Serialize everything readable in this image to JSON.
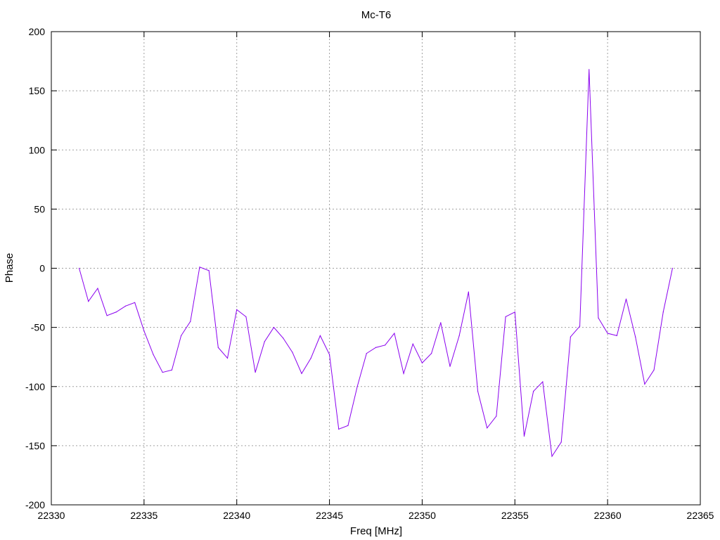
{
  "chart_data": {
    "type": "line",
    "title": "Mc-T6",
    "xlabel": "Freq [MHz]",
    "ylabel": "Phase",
    "xlim": [
      22330,
      22365
    ],
    "ylim": [
      -200,
      200
    ],
    "xticks": [
      22330,
      22335,
      22340,
      22345,
      22350,
      22355,
      22360,
      22365
    ],
    "yticks": [
      -200,
      -150,
      -100,
      -50,
      0,
      50,
      100,
      150,
      200
    ],
    "grid": true,
    "legend": "none",
    "series_color": "#8a00ef",
    "series": [
      {
        "x": [
          22331.5,
          22332,
          22332.5,
          22333,
          22333.5,
          22334,
          22334.5,
          22335,
          22335.5,
          22336,
          22336.5,
          22337,
          22337.5,
          22338,
          22338.5,
          22339,
          22339.5,
          22340,
          22340.5,
          22341,
          22341.5,
          22342,
          22342.5,
          22343,
          22343.5,
          22344,
          22344.5,
          22345,
          22345.5,
          22346,
          22346.5,
          22347,
          22347.5,
          22348,
          22348.5,
          22349,
          22349.5,
          22350,
          22350.5,
          22351,
          22351.5,
          22352,
          22352.5,
          22353,
          22353.5,
          22354,
          22354.5,
          22355,
          22355.5,
          22356,
          22356.5,
          22357,
          22357.5,
          22358,
          22358.5,
          22359,
          22359.5,
          22360,
          22360.5,
          22361,
          22361.5,
          22362,
          22362.5,
          22363,
          22363.5
        ],
        "values": [
          0,
          -28,
          -17,
          -40,
          -37,
          -32,
          -29,
          -53,
          -73,
          -88,
          -86,
          -57,
          -45,
          1,
          -2,
          -67,
          -76,
          -35,
          -41,
          -88,
          -62,
          -50,
          -59,
          -71,
          -89,
          -76,
          -57,
          -73,
          -136,
          -133,
          -100,
          -72,
          -67,
          -65,
          -55,
          -89,
          -64,
          -80,
          -72,
          -46,
          -83,
          -57,
          -20,
          -104,
          -135,
          -125,
          -41,
          -37,
          -142,
          -104,
          -96,
          -159,
          -147,
          -58,
          -49,
          168,
          -42,
          -55,
          -57,
          -26,
          -58,
          -98,
          -86,
          -37,
          0
        ]
      }
    ]
  }
}
